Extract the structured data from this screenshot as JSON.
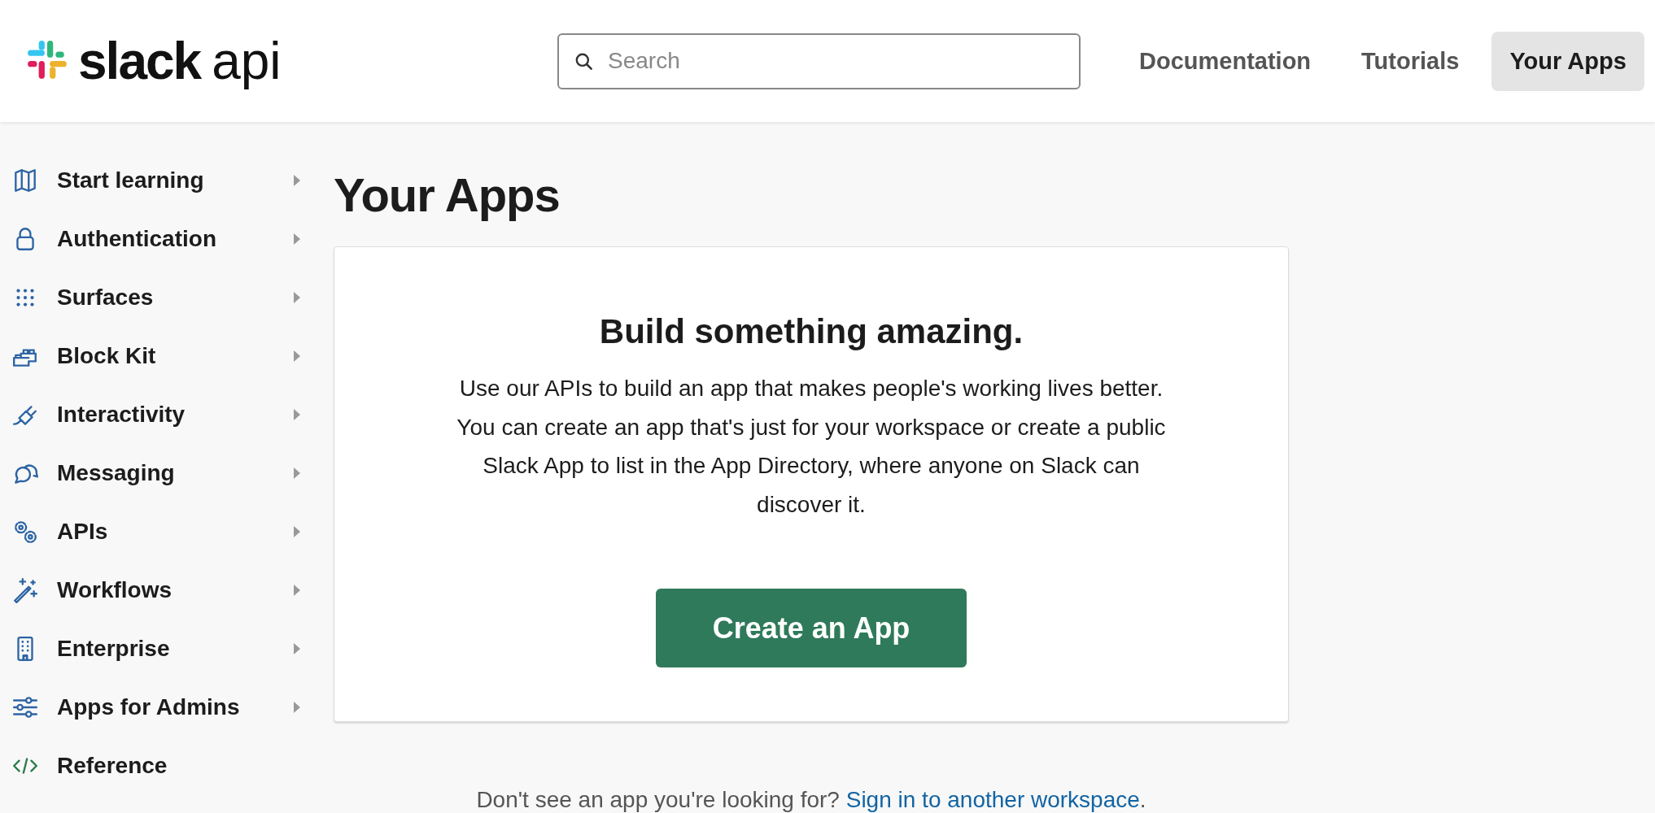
{
  "header": {
    "logo": {
      "brand": "slack",
      "product": "api"
    },
    "search": {
      "placeholder": "Search"
    },
    "nav": [
      {
        "label": "Documentation",
        "selected": false
      },
      {
        "label": "Tutorials",
        "selected": false
      },
      {
        "label": "Your Apps",
        "selected": true
      }
    ]
  },
  "sidebar": {
    "items": [
      {
        "label": "Start learning",
        "expandable": true
      },
      {
        "label": "Authentication",
        "expandable": true
      },
      {
        "label": "Surfaces",
        "expandable": true
      },
      {
        "label": "Block Kit",
        "expandable": true
      },
      {
        "label": "Interactivity",
        "expandable": true
      },
      {
        "label": "Messaging",
        "expandable": true
      },
      {
        "label": "APIs",
        "expandable": true
      },
      {
        "label": "Workflows",
        "expandable": true
      },
      {
        "label": "Enterprise",
        "expandable": true
      },
      {
        "label": "Apps for Admins",
        "expandable": true
      },
      {
        "label": "Reference",
        "expandable": false
      }
    ]
  },
  "main": {
    "title": "Your Apps",
    "card": {
      "heading": "Build something amazing.",
      "body": "Use our APIs to build an app that makes people's working lives better. You can create an app that's just for your workspace or create a public Slack App to list in the App Directory, where anyone on Slack can discover it.",
      "button": "Create an App"
    },
    "footer": {
      "text": "Don't see an app you're looking for?",
      "link": "Sign in to another workspace",
      "end": "."
    }
  }
}
